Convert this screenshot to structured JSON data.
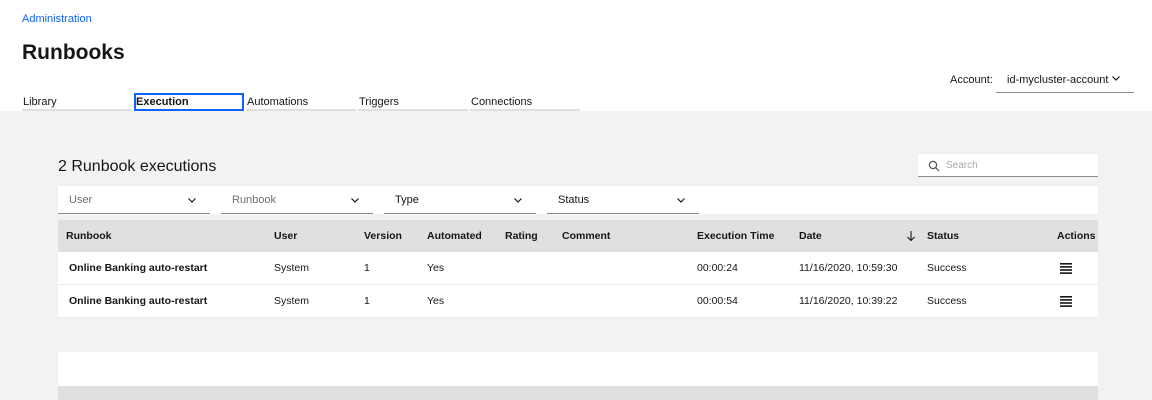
{
  "breadcrumb": "Administration",
  "page_title": "Runbooks",
  "tabs": [
    {
      "label": "Library",
      "active": false
    },
    {
      "label": "Execution",
      "active": true
    },
    {
      "label": "Automations",
      "active": false
    },
    {
      "label": "Triggers",
      "active": false
    },
    {
      "label": "Connections",
      "active": false
    }
  ],
  "account": {
    "label": "Account:",
    "value": "id-mycluster-account",
    "icon": "chevron-down-icon"
  },
  "executions": {
    "title": "2 Runbook executions",
    "search": {
      "placeholder": "Search",
      "icon": "search-icon"
    },
    "filters": [
      {
        "label": "User"
      },
      {
        "label": "Runbook"
      },
      {
        "label": "Type"
      },
      {
        "label": "Status"
      }
    ],
    "columns": {
      "runbook": "Runbook",
      "user": "User",
      "version": "Version",
      "automated": "Automated",
      "rating": "Rating",
      "comment": "Comment",
      "execution_time": "Execution Time",
      "date": "Date",
      "status": "Status",
      "actions": "Actions"
    },
    "sort_icon": "arrow-down-icon",
    "action_icon": "menu-icon",
    "rows": [
      {
        "runbook": "Online Banking auto-restart",
        "user": "System",
        "version": "1",
        "automated": "Yes",
        "rating": "",
        "comment": "",
        "execution_time": "00:00:24",
        "date": "11/16/2020, 10:59:30",
        "status": "Success"
      },
      {
        "runbook": "Online Banking auto-restart",
        "user": "System",
        "version": "1",
        "automated": "Yes",
        "rating": "",
        "comment": "",
        "execution_time": "00:00:54",
        "date": "11/16/2020, 10:39:22",
        "status": "Success"
      }
    ]
  },
  "colors": {
    "accent": "#0f62fe",
    "background": "#f2f2f2",
    "table_header": "#e0e0e0"
  }
}
